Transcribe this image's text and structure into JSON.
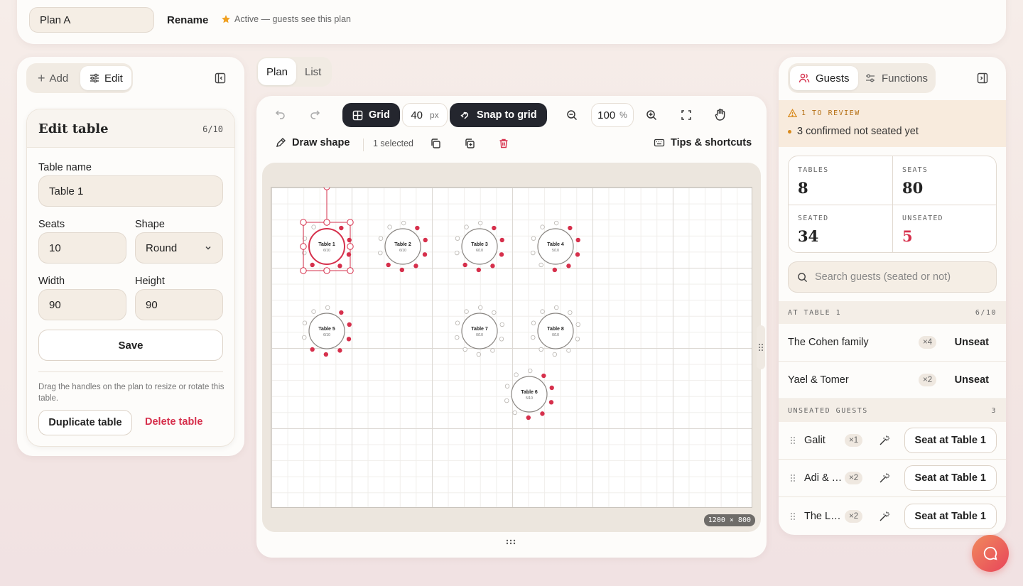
{
  "topbar": {
    "plan_name": "Plan A",
    "rename_label": "Rename",
    "active_text": "Active — guests see this plan"
  },
  "left_panel": {
    "add_label": "Add",
    "edit_label": "Edit",
    "edit_title": "Edit table",
    "count": "6/10",
    "table_name_label": "Table name",
    "table_name_value": "Table 1",
    "seats_label": "Seats",
    "seats_value": "10",
    "shape_label": "Shape",
    "shape_value": "Round",
    "width_label": "Width",
    "width_value": "90",
    "height_label": "Height",
    "height_value": "90",
    "save_label": "Save",
    "hint": "Drag the handles on the plan to resize or rotate this table.",
    "duplicate_label": "Duplicate table",
    "delete_label": "Delete table"
  },
  "view_tabs": {
    "plan": "Plan",
    "list": "List"
  },
  "toolbar": {
    "grid_label": "Grid",
    "grid_size": "40",
    "grid_unit": "px",
    "snap_label": "Snap to grid",
    "zoom_value": "100",
    "zoom_unit": "%",
    "draw_shape_label": "Draw shape",
    "selected_text": "1 selected",
    "tips_label": "Tips & shortcuts"
  },
  "canvas": {
    "dimensions": "1200 × 800",
    "tables": [
      {
        "name": "Table 1",
        "count": "6/10",
        "seated": 6,
        "seats": 10,
        "selected": true
      },
      {
        "name": "Table 2",
        "count": "6/10",
        "seated": 6,
        "seats": 10
      },
      {
        "name": "Table 3",
        "count": "6/10",
        "seated": 6,
        "seats": 10
      },
      {
        "name": "Table 4",
        "count": "5/10",
        "seated": 5,
        "seats": 10
      },
      {
        "name": "Table 5",
        "count": "6/10",
        "seated": 6,
        "seats": 10
      },
      {
        "name": "Table 7",
        "count": "0/10",
        "seated": 0,
        "seats": 10
      },
      {
        "name": "Table 8",
        "count": "0/10",
        "seated": 0,
        "seats": 10
      },
      {
        "name": "Table 6",
        "count": "5/10",
        "seated": 5,
        "seats": 10
      }
    ]
  },
  "right_panel": {
    "guests_tab": "Guests",
    "functions_tab": "Functions",
    "review_title": "1 TO REVIEW",
    "review_item": "3 confirmed not seated yet",
    "stats": [
      {
        "label": "TABLES",
        "value": "8"
      },
      {
        "label": "SEATS",
        "value": "80"
      },
      {
        "label": "SEATED",
        "value": "34"
      },
      {
        "label": "UNSEATED",
        "value": "5"
      }
    ],
    "search_placeholder": "Search guests (seated or not)",
    "at_table_title": "AT TABLE 1",
    "at_table_count": "6/10",
    "at_table_guests": [
      {
        "name": "The Cohen family",
        "count": "×4",
        "action": "Unseat"
      },
      {
        "name": "Yael & Tomer",
        "count": "×2",
        "action": "Unseat"
      }
    ],
    "unseated_title": "UNSEATED GUESTS",
    "unseated_count": "3",
    "unseated_guests": [
      {
        "name": "Galit",
        "count": "×1",
        "action": "Seat at Table 1"
      },
      {
        "name": "Adi & …",
        "count": "×2",
        "action": "Seat at Table 1"
      },
      {
        "name": "The L…",
        "count": "×2",
        "action": "Seat at Table 1"
      }
    ]
  },
  "colors": {
    "accent": "#d6304c",
    "dark": "#24262e",
    "star": "#f0a020"
  }
}
